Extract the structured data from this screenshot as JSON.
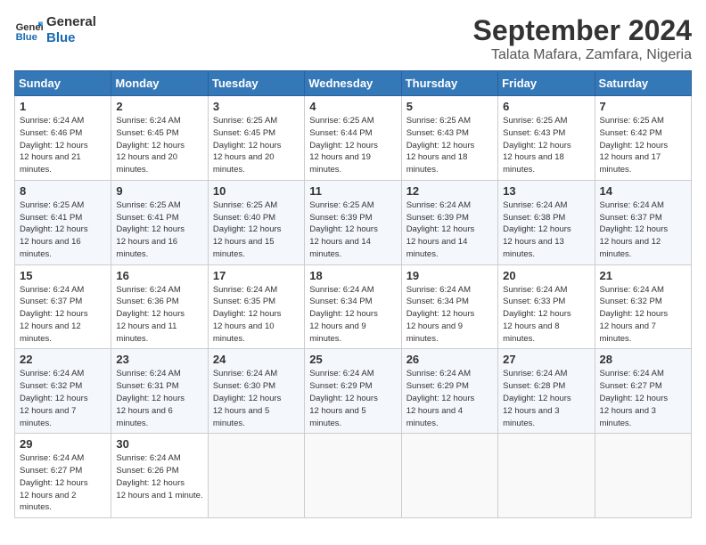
{
  "logo": {
    "line1": "General",
    "line2": "Blue"
  },
  "title": "September 2024",
  "subtitle": "Talata Mafara, Zamfara, Nigeria",
  "days_of_week": [
    "Sunday",
    "Monday",
    "Tuesday",
    "Wednesday",
    "Thursday",
    "Friday",
    "Saturday"
  ],
  "weeks": [
    [
      {
        "day": "1",
        "sunrise": "6:24 AM",
        "sunset": "6:46 PM",
        "daylight": "12 hours and 21 minutes."
      },
      {
        "day": "2",
        "sunrise": "6:24 AM",
        "sunset": "6:45 PM",
        "daylight": "12 hours and 20 minutes."
      },
      {
        "day": "3",
        "sunrise": "6:25 AM",
        "sunset": "6:45 PM",
        "daylight": "12 hours and 20 minutes."
      },
      {
        "day": "4",
        "sunrise": "6:25 AM",
        "sunset": "6:44 PM",
        "daylight": "12 hours and 19 minutes."
      },
      {
        "day": "5",
        "sunrise": "6:25 AM",
        "sunset": "6:43 PM",
        "daylight": "12 hours and 18 minutes."
      },
      {
        "day": "6",
        "sunrise": "6:25 AM",
        "sunset": "6:43 PM",
        "daylight": "12 hours and 18 minutes."
      },
      {
        "day": "7",
        "sunrise": "6:25 AM",
        "sunset": "6:42 PM",
        "daylight": "12 hours and 17 minutes."
      }
    ],
    [
      {
        "day": "8",
        "sunrise": "6:25 AM",
        "sunset": "6:41 PM",
        "daylight": "12 hours and 16 minutes."
      },
      {
        "day": "9",
        "sunrise": "6:25 AM",
        "sunset": "6:41 PM",
        "daylight": "12 hours and 16 minutes."
      },
      {
        "day": "10",
        "sunrise": "6:25 AM",
        "sunset": "6:40 PM",
        "daylight": "12 hours and 15 minutes."
      },
      {
        "day": "11",
        "sunrise": "6:25 AM",
        "sunset": "6:39 PM",
        "daylight": "12 hours and 14 minutes."
      },
      {
        "day": "12",
        "sunrise": "6:24 AM",
        "sunset": "6:39 PM",
        "daylight": "12 hours and 14 minutes."
      },
      {
        "day": "13",
        "sunrise": "6:24 AM",
        "sunset": "6:38 PM",
        "daylight": "12 hours and 13 minutes."
      },
      {
        "day": "14",
        "sunrise": "6:24 AM",
        "sunset": "6:37 PM",
        "daylight": "12 hours and 12 minutes."
      }
    ],
    [
      {
        "day": "15",
        "sunrise": "6:24 AM",
        "sunset": "6:37 PM",
        "daylight": "12 hours and 12 minutes."
      },
      {
        "day": "16",
        "sunrise": "6:24 AM",
        "sunset": "6:36 PM",
        "daylight": "12 hours and 11 minutes."
      },
      {
        "day": "17",
        "sunrise": "6:24 AM",
        "sunset": "6:35 PM",
        "daylight": "12 hours and 10 minutes."
      },
      {
        "day": "18",
        "sunrise": "6:24 AM",
        "sunset": "6:34 PM",
        "daylight": "12 hours and 9 minutes."
      },
      {
        "day": "19",
        "sunrise": "6:24 AM",
        "sunset": "6:34 PM",
        "daylight": "12 hours and 9 minutes."
      },
      {
        "day": "20",
        "sunrise": "6:24 AM",
        "sunset": "6:33 PM",
        "daylight": "12 hours and 8 minutes."
      },
      {
        "day": "21",
        "sunrise": "6:24 AM",
        "sunset": "6:32 PM",
        "daylight": "12 hours and 7 minutes."
      }
    ],
    [
      {
        "day": "22",
        "sunrise": "6:24 AM",
        "sunset": "6:32 PM",
        "daylight": "12 hours and 7 minutes."
      },
      {
        "day": "23",
        "sunrise": "6:24 AM",
        "sunset": "6:31 PM",
        "daylight": "12 hours and 6 minutes."
      },
      {
        "day": "24",
        "sunrise": "6:24 AM",
        "sunset": "6:30 PM",
        "daylight": "12 hours and 5 minutes."
      },
      {
        "day": "25",
        "sunrise": "6:24 AM",
        "sunset": "6:29 PM",
        "daylight": "12 hours and 5 minutes."
      },
      {
        "day": "26",
        "sunrise": "6:24 AM",
        "sunset": "6:29 PM",
        "daylight": "12 hours and 4 minutes."
      },
      {
        "day": "27",
        "sunrise": "6:24 AM",
        "sunset": "6:28 PM",
        "daylight": "12 hours and 3 minutes."
      },
      {
        "day": "28",
        "sunrise": "6:24 AM",
        "sunset": "6:27 PM",
        "daylight": "12 hours and 3 minutes."
      }
    ],
    [
      {
        "day": "29",
        "sunrise": "6:24 AM",
        "sunset": "6:27 PM",
        "daylight": "12 hours and 2 minutes."
      },
      {
        "day": "30",
        "sunrise": "6:24 AM",
        "sunset": "6:26 PM",
        "daylight": "12 hours and 1 minute."
      },
      null,
      null,
      null,
      null,
      null
    ]
  ]
}
